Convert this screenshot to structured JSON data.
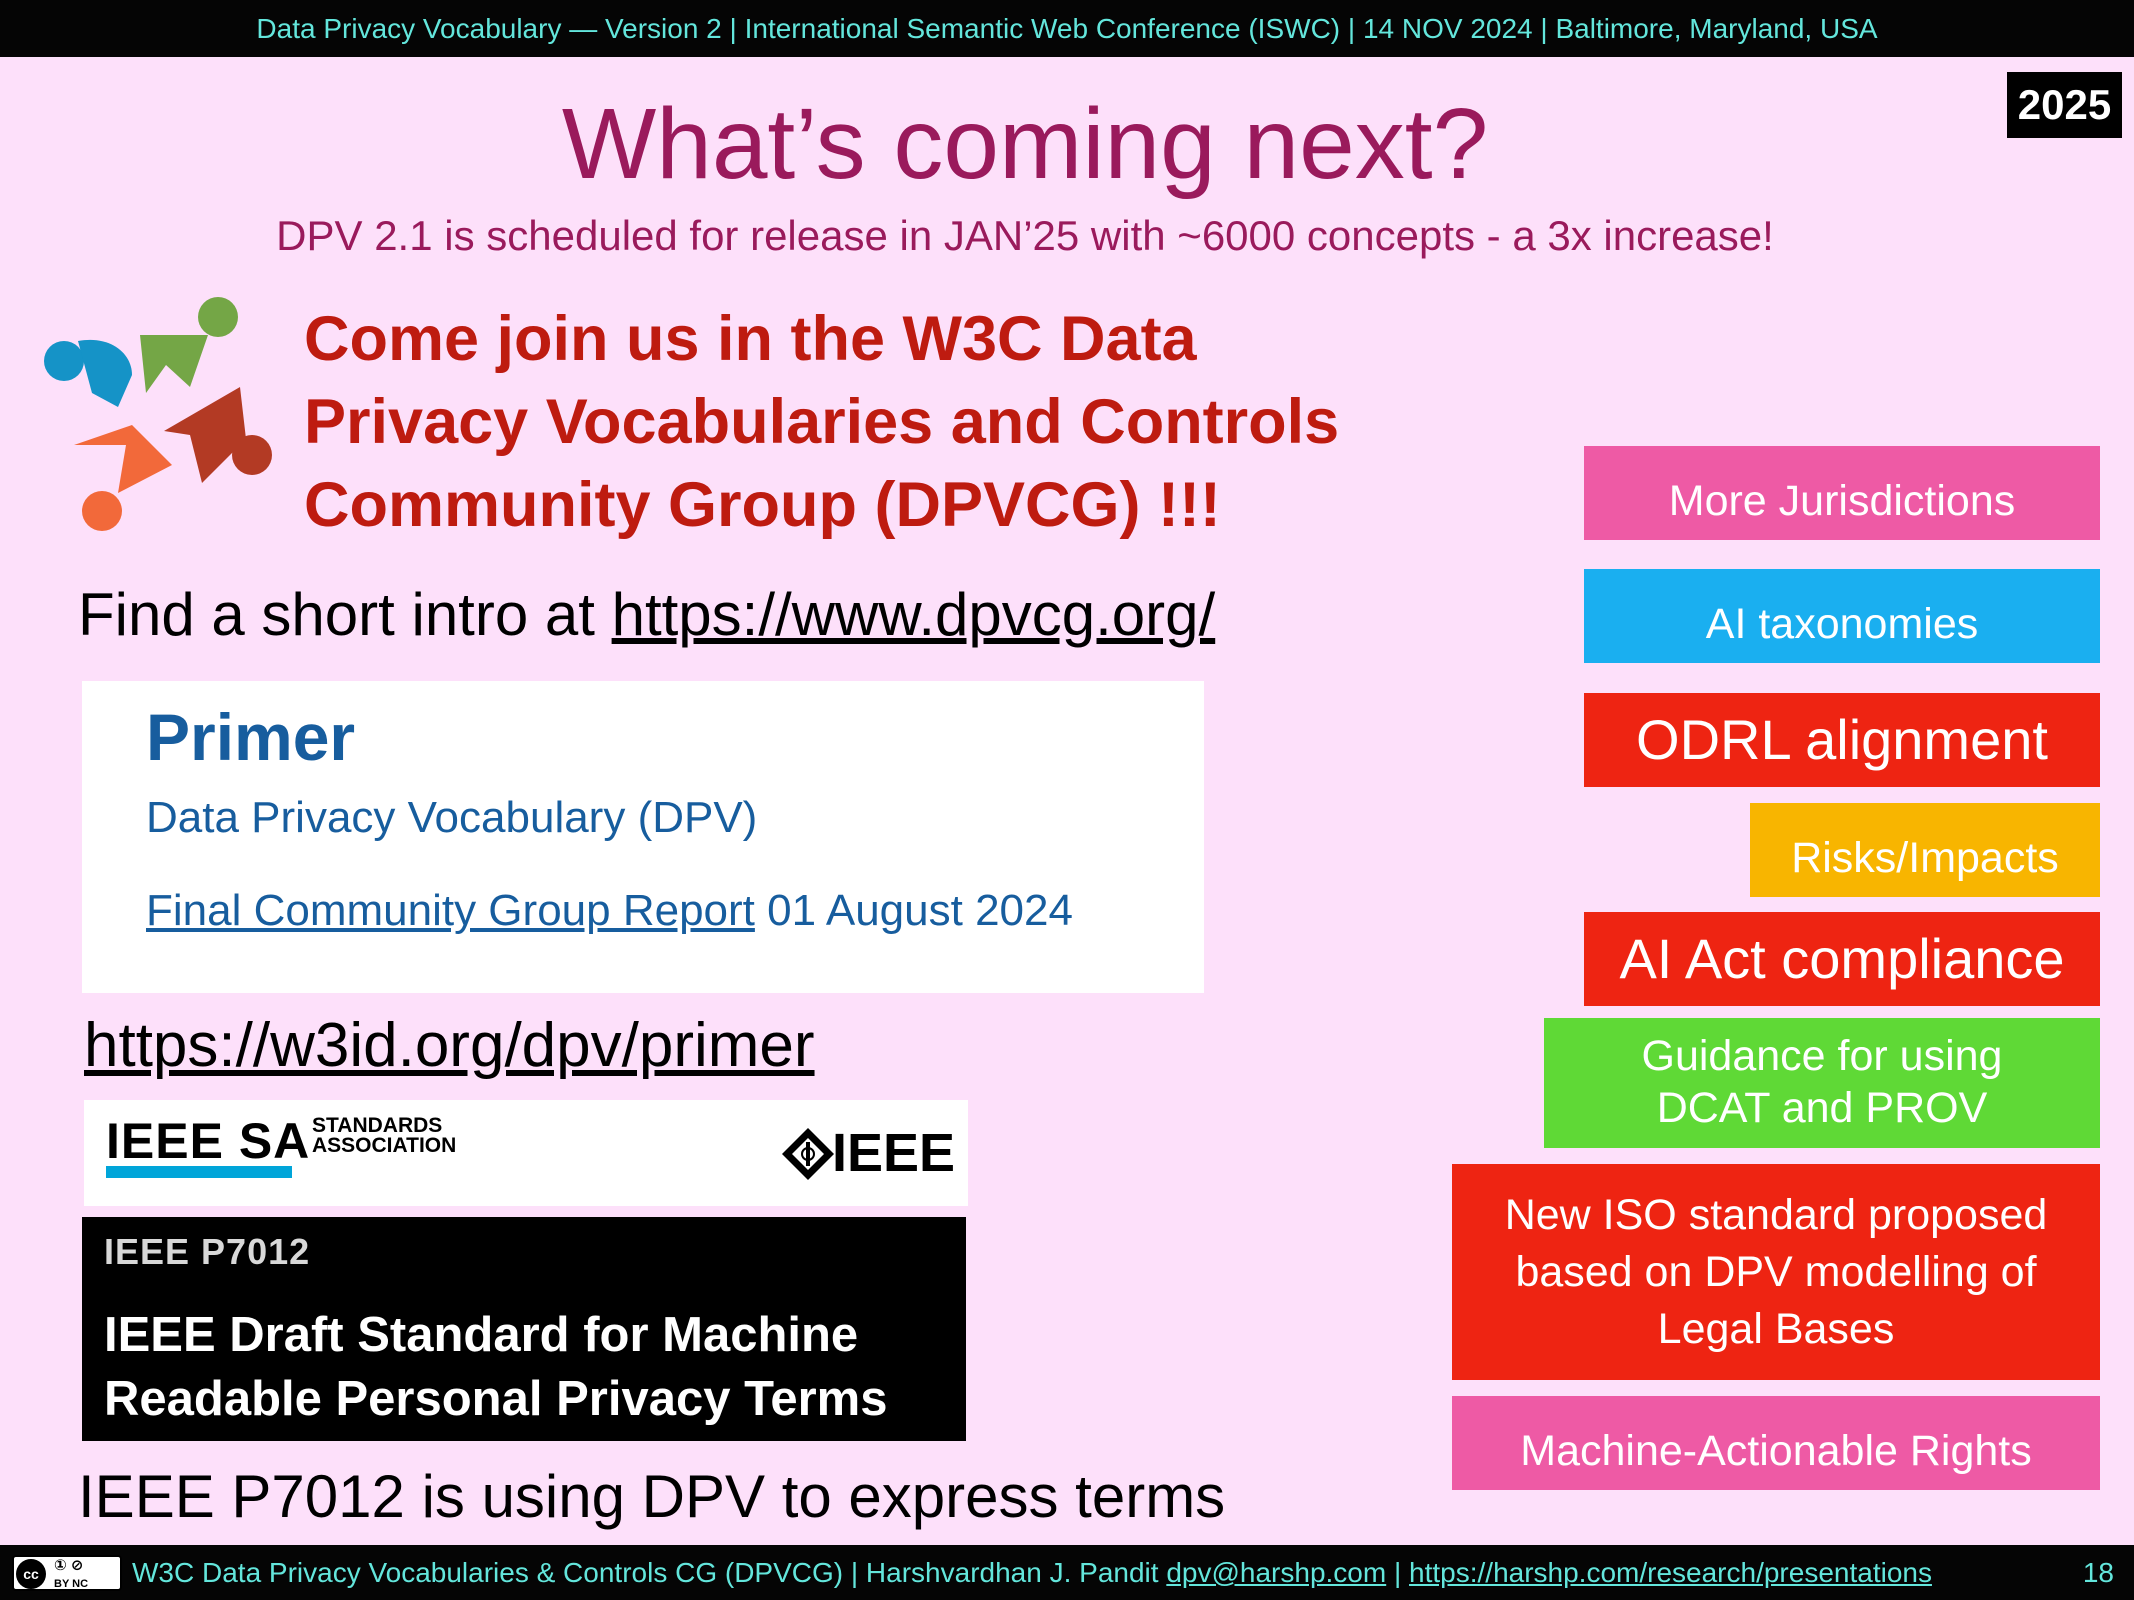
{
  "header": {
    "bar_text": "Data Privacy Vocabulary — Version 2 | International Semantic Web Conference (ISWC) | 14 NOV 2024 | Baltimore, Maryland, USA",
    "year_badge": "2025"
  },
  "slide": {
    "title": "What’s coming next?",
    "subtitle": "DPV 2.1 is scheduled for release in JAN’25 with ~6000 concepts - a 3x increase!",
    "join_line1": "Come join us in the W3C Data",
    "join_line2": "Privacy Vocabularies and Controls",
    "join_line3": "Community Group (DPVCG) !!!",
    "intro_prefix": "Find a short intro at ",
    "intro_link": "https://www.dpvcg.org/",
    "primer": {
      "title": "Primer",
      "subtitle": "Data Privacy Vocabulary (DPV)",
      "report_link": "Final Community Group Report",
      "report_date": " 01 August 2024"
    },
    "primer_url": "https://w3id.org/dpv/primer",
    "ieee": {
      "sa_text": "IEEE SA",
      "assoc_line1": "STANDARDS",
      "assoc_line2": "ASSOCIATION",
      "wordmark": "IEEE"
    },
    "p7012": {
      "label": "IEEE P7012",
      "title_line1": "IEEE Draft Standard for Machine",
      "title_line2": "Readable Personal Privacy Terms"
    },
    "using_text": "IEEE P7012 is using DPV to express terms",
    "roadmap": [
      {
        "label": "More Jurisdictions",
        "color": "#ee5aa5"
      },
      {
        "label": "AI taxonomies",
        "color": "#1aaff0"
      },
      {
        "label": "ODRL alignment",
        "color": "#ee2412"
      },
      {
        "label": "Risks/Impacts",
        "color": "#f8b500"
      },
      {
        "label": "AI Act compliance",
        "color": "#ee2412"
      },
      {
        "label_line1": "Guidance for using",
        "label_line2": "DCAT and PROV",
        "color": "#5fd936"
      },
      {
        "label_line1": "New ISO standard proposed",
        "label_line2": "based on DPV modelling of",
        "label_line3": "Legal Bases",
        "color": "#ee2412"
      },
      {
        "label": "Machine-Actionable Rights",
        "color": "#ee5aa5"
      }
    ]
  },
  "footer": {
    "license_cc": "cc",
    "license_by": "BY",
    "license_nc": "NC",
    "text_prefix": "W3C Data Privacy Vocabularies & Controls CG (DPVCG) | Harshvardhan J. Pandit ",
    "email": "dpv@harshp.com",
    "separator": " | ",
    "presentations_link": "https://harshp.com/research/presentations",
    "page_number": "18"
  }
}
